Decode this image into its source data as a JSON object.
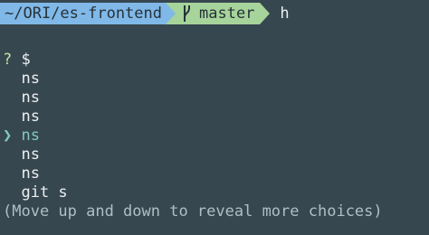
{
  "prompt": {
    "path": "~/ORI/es-frontend",
    "branch_icon": "git-branch-icon",
    "branch": "master",
    "typed_command": "h"
  },
  "question": {
    "marker": "?",
    "symbol": "$"
  },
  "choices": [
    {
      "label": "ns",
      "selected": false
    },
    {
      "label": "ns",
      "selected": false
    },
    {
      "label": "ns",
      "selected": false
    },
    {
      "label": "ns",
      "selected": true
    },
    {
      "label": "ns",
      "selected": false
    },
    {
      "label": "ns",
      "selected": false
    },
    {
      "label": "git s",
      "selected": false
    }
  ],
  "pointer_glyph": "❯",
  "hint": "(Move up and down to reveal more choices)",
  "colors": {
    "background": "#37474f",
    "path_segment": "#80b8e8",
    "branch_segment": "#a6d49a",
    "selected": "#80cbc4"
  }
}
